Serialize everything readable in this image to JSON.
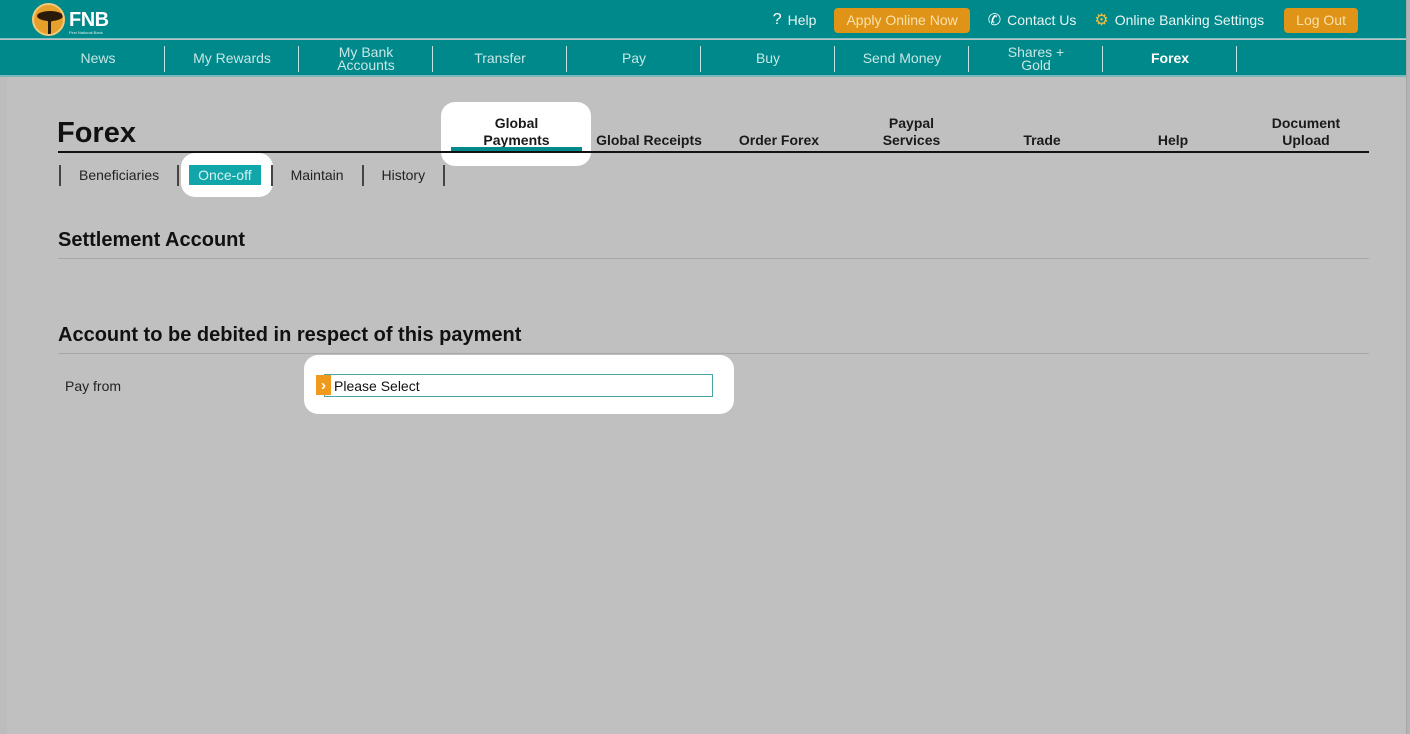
{
  "brand": {
    "name": "FNB",
    "tagline": "First National Bank",
    "accent": "#00898a",
    "orange": "#e09417"
  },
  "header": {
    "help": "Help",
    "apply": "Apply Online Now",
    "contact": "Contact Us",
    "settings": "Online Banking Settings",
    "logout": "Log Out",
    "icons": {
      "help": "question-mark-icon",
      "contact": "phone-icon",
      "settings": "gear-icon"
    }
  },
  "mainnav": {
    "items": [
      {
        "label": "News"
      },
      {
        "label": "My Rewards"
      },
      {
        "label": "My Bank Accounts"
      },
      {
        "label": "Transfer"
      },
      {
        "label": "Pay"
      },
      {
        "label": "Buy"
      },
      {
        "label": "Send Money"
      },
      {
        "label": "Shares + Gold"
      },
      {
        "label": "Forex",
        "active": true
      }
    ]
  },
  "page": {
    "title": "Forex",
    "tabs": [
      {
        "label": "Global Payments",
        "active": true
      },
      {
        "label": "Global Receipts"
      },
      {
        "label": "Order Forex"
      },
      {
        "label": "Paypal Services"
      },
      {
        "label": "Trade"
      },
      {
        "label": "Help"
      },
      {
        "label": "Document Upload"
      }
    ],
    "subtabs": [
      {
        "label": "Beneficiaries"
      },
      {
        "label": "Once-off",
        "active": true
      },
      {
        "label": "Maintain"
      },
      {
        "label": "History"
      }
    ]
  },
  "form": {
    "settlement_heading": "Settlement Account",
    "debit_heading": "Account to be debited in respect of this payment",
    "pay_from_label": "Pay from",
    "pay_from_value": "Please Select"
  }
}
